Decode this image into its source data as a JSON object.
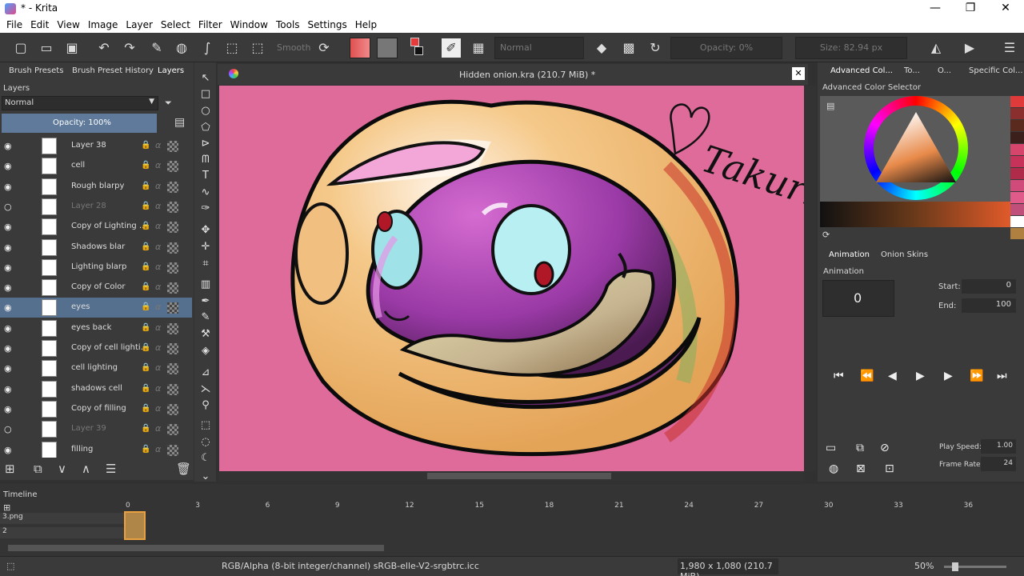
{
  "window": {
    "title": "* - Krita",
    "min_glyph": "—",
    "max_glyph": "❐",
    "close_glyph": "✕"
  },
  "menu": [
    "File",
    "Edit",
    "View",
    "Image",
    "Layer",
    "Select",
    "Filter",
    "Window",
    "Tools",
    "Settings",
    "Help"
  ],
  "toolbar": {
    "smooth_label": "Smooth",
    "blend_mode": "Normal",
    "opacity": "Opacity: 0%",
    "size": "Size: 82.94 px",
    "color_fg": "#e53b3b",
    "color_bg": "#111111"
  },
  "left_dock": {
    "tabs": [
      "Brush Presets",
      "Brush Preset History",
      "Layers"
    ],
    "panel_title": "Layers",
    "blend_mode": "Normal",
    "opacity": "Opacity:  100%",
    "layers": [
      {
        "name": "Layer 38",
        "visible": true,
        "selected": false,
        "dim": false
      },
      {
        "name": "cell",
        "visible": true,
        "selected": false,
        "dim": false
      },
      {
        "name": "Rough blarpy",
        "visible": true,
        "selected": false,
        "dim": false
      },
      {
        "name": "Layer 28",
        "visible": false,
        "selected": false,
        "dim": true
      },
      {
        "name": "Copy of Lighting ...",
        "visible": true,
        "selected": false,
        "dim": false
      },
      {
        "name": "Shadows blar",
        "visible": true,
        "selected": false,
        "dim": false
      },
      {
        "name": "Lighting blarp",
        "visible": true,
        "selected": false,
        "dim": false
      },
      {
        "name": "Copy of Color",
        "visible": true,
        "selected": false,
        "dim": false
      },
      {
        "name": "eyes",
        "visible": true,
        "selected": true,
        "dim": false
      },
      {
        "name": "eyes back",
        "visible": true,
        "selected": false,
        "dim": false
      },
      {
        "name": "Copy of cell lighti...",
        "visible": true,
        "selected": false,
        "dim": false
      },
      {
        "name": "cell lighting",
        "visible": true,
        "selected": false,
        "dim": false
      },
      {
        "name": "shadows cell",
        "visible": true,
        "selected": false,
        "dim": false
      },
      {
        "name": "Copy of filling",
        "visible": true,
        "selected": false,
        "dim": false
      },
      {
        "name": "Layer 39",
        "visible": false,
        "selected": false,
        "dim": true
      },
      {
        "name": "filling",
        "visible": true,
        "selected": false,
        "dim": false
      }
    ]
  },
  "document": {
    "title": "Hidden onion.kra (210.7 MiB) *",
    "signature": "Takuri"
  },
  "right_dock": {
    "tabs": [
      "Advanced Col...",
      "To...",
      "O...",
      "Specific Col..."
    ],
    "color_selector_title": "Advanced Color Selector",
    "anim_tabs": [
      "Animation",
      "Onion Skins"
    ],
    "anim_title": "Animation",
    "current_frame": "0",
    "start_label": "Start:",
    "start_value": "0",
    "end_label": "End:",
    "end_value": "100",
    "play_speed_label": "Play Speed:",
    "play_speed_value": "1.00",
    "frame_rate_label": "Frame Rate:",
    "frame_rate_value": "24",
    "swatches": [
      "#e03a3a",
      "#8b2e2e",
      "#5a2a1e",
      "#3a1f1a",
      "#d6456b",
      "#c7325a",
      "#b02a4a",
      "#d04a7a",
      "#e05a8a",
      "#c0507a",
      "#ffffff",
      "#b08040"
    ]
  },
  "timeline": {
    "title": "Timeline",
    "frame_ticks": [
      "0",
      "3",
      "6",
      "9",
      "12",
      "15",
      "18",
      "21",
      "24",
      "27",
      "30",
      "33",
      "36"
    ],
    "rows": [
      "3.png",
      "2"
    ]
  },
  "status": {
    "color_space": "RGB/Alpha (8-bit integer/channel)  sRGB-elle-V2-srgbtrc.icc",
    "dimensions": "1,980 x 1,080 (210.7 MiB)",
    "zoom": "50%"
  }
}
